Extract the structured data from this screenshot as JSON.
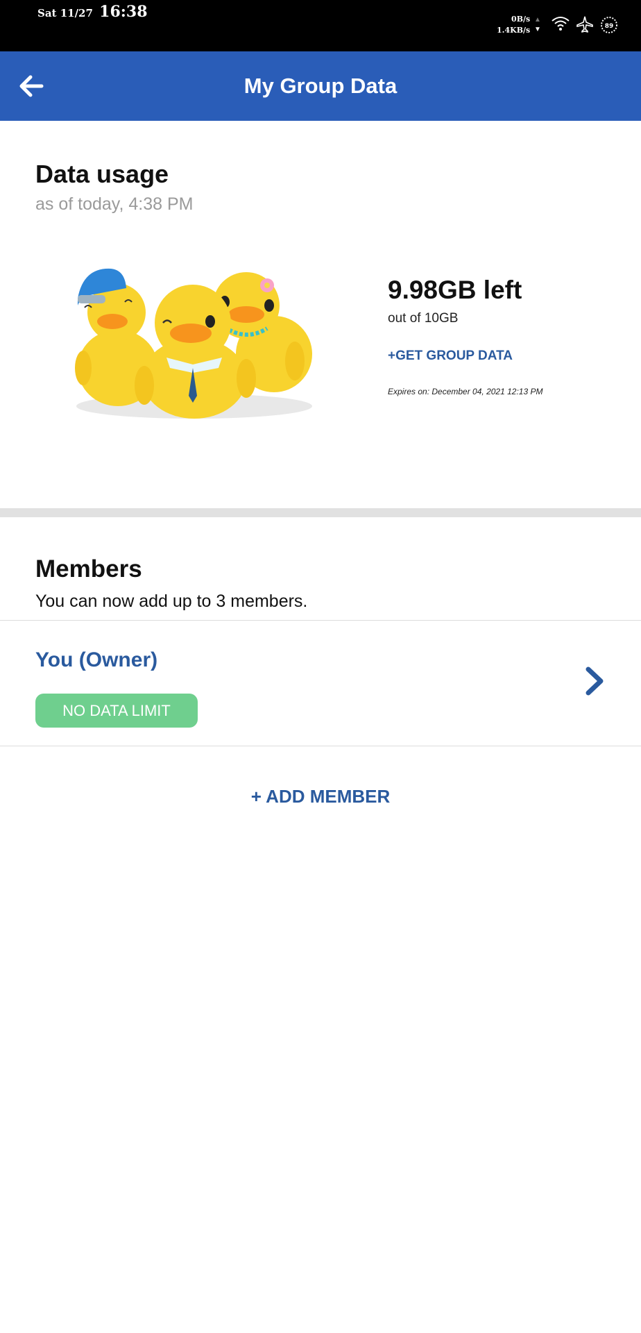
{
  "status_bar": {
    "date": "Sat 11/27",
    "time": "16:38",
    "upload_speed": "0B/s",
    "download_speed": "1.4KB/s",
    "icons": [
      "wifi-icon",
      "airplane-mode-icon",
      "battery-icon"
    ],
    "battery_level": "89"
  },
  "app_bar": {
    "title": "My Group Data",
    "back_icon": "arrow-left-icon"
  },
  "data_usage": {
    "title": "Data usage",
    "as_of": "as of today, 4:38 PM",
    "left": "9.98GB left",
    "out_of": "out of 10GB",
    "get_data_label": "+GET GROUP DATA",
    "expires": "Expires on: December 04, 2021 12:13 PM"
  },
  "members": {
    "title": "Members",
    "subtitle": "You can now add up to 3 members.",
    "items": [
      {
        "name": "You (Owner)",
        "badge": "NO DATA LIMIT",
        "badge_color": "#6fcf8e"
      }
    ],
    "add_label": "+ ADD MEMBER"
  },
  "colors": {
    "primary": "#2a5db8",
    "link": "#2a5a9e",
    "badge_green": "#6fcf8e"
  }
}
